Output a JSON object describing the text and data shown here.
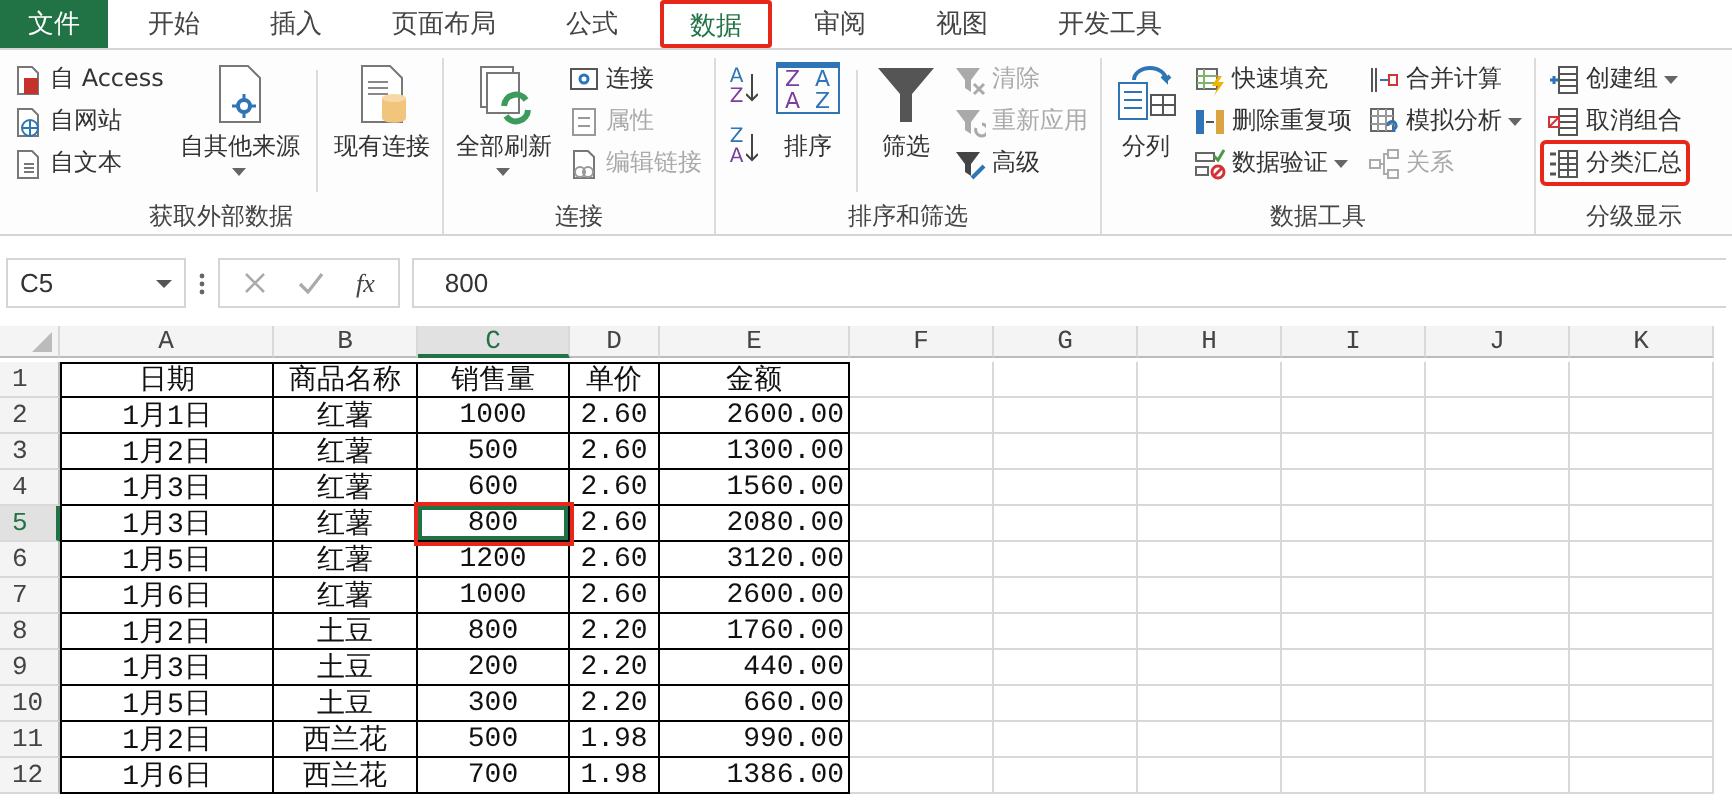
{
  "tabs": [
    {
      "label": "文件",
      "kind": "file",
      "selected": false,
      "highlighted": false
    },
    {
      "label": "开始",
      "kind": "tab",
      "selected": false,
      "highlighted": false
    },
    {
      "label": "插入",
      "kind": "tab",
      "selected": false,
      "highlighted": false
    },
    {
      "label": "页面布局",
      "kind": "tab",
      "selected": false,
      "highlighted": false
    },
    {
      "label": "公式",
      "kind": "tab",
      "selected": false,
      "highlighted": false
    },
    {
      "label": "数据",
      "kind": "tab",
      "selected": true,
      "highlighted": true
    },
    {
      "label": "审阅",
      "kind": "tab",
      "selected": false,
      "highlighted": false
    },
    {
      "label": "视图",
      "kind": "tab",
      "selected": false,
      "highlighted": false
    },
    {
      "label": "开发工具",
      "kind": "tab",
      "selected": false,
      "highlighted": false
    }
  ],
  "ribbon": {
    "groups": [
      {
        "label": "获取外部数据",
        "columns": [
          {
            "kind": "stack",
            "items": [
              {
                "label": "自 Access",
                "disabled": false,
                "caret": false,
                "highlighted": false
              },
              {
                "label": "自网站",
                "disabled": false,
                "caret": false,
                "highlighted": false
              },
              {
                "label": "自文本",
                "disabled": false,
                "caret": false,
                "highlighted": false
              }
            ]
          },
          {
            "kind": "large",
            "label": "自其他来源",
            "disabled": false,
            "caret": true
          },
          {
            "kind": "separator"
          },
          {
            "kind": "large",
            "label": "现有连接",
            "disabled": false,
            "caret": false
          }
        ]
      },
      {
        "label": "连接",
        "columns": [
          {
            "kind": "large",
            "label": "全部刷新",
            "disabled": false,
            "caret": true
          },
          {
            "kind": "stack",
            "items": [
              {
                "label": "连接",
                "disabled": false,
                "caret": false,
                "highlighted": false
              },
              {
                "label": "属性",
                "disabled": true,
                "caret": false,
                "highlighted": false
              },
              {
                "label": "编辑链接",
                "disabled": true,
                "caret": false,
                "highlighted": false
              }
            ]
          }
        ]
      },
      {
        "label": "排序和筛选",
        "columns": [
          {
            "kind": "sort_stack",
            "items": [
              {
                "top": "A",
                "bottom": "Z"
              },
              {
                "top": "Z",
                "bottom": "A"
              }
            ]
          },
          {
            "kind": "sort_large",
            "label": "排序",
            "letters": [
              "Z",
              "A",
              "A",
              "Z"
            ],
            "disabled": false,
            "caret": false
          },
          {
            "kind": "separator"
          },
          {
            "kind": "large",
            "label": "筛选",
            "disabled": false,
            "caret": false
          },
          {
            "kind": "stack",
            "items": [
              {
                "label": "清除",
                "disabled": true,
                "caret": false,
                "highlighted": false
              },
              {
                "label": "重新应用",
                "disabled": true,
                "caret": false,
                "highlighted": false
              },
              {
                "label": "高级",
                "disabled": false,
                "caret": false,
                "highlighted": false
              }
            ]
          }
        ]
      },
      {
        "label": "数据工具",
        "columns": [
          {
            "kind": "large",
            "label": "分列",
            "disabled": false,
            "caret": false
          },
          {
            "kind": "stack",
            "items": [
              {
                "label": "快速填充",
                "disabled": false,
                "caret": false,
                "highlighted": false
              },
              {
                "label": "删除重复项",
                "disabled": false,
                "caret": false,
                "highlighted": false
              },
              {
                "label": "数据验证",
                "disabled": false,
                "caret": true,
                "highlighted": false
              }
            ]
          },
          {
            "kind": "stack",
            "items": [
              {
                "label": "合并计算",
                "disabled": false,
                "caret": false,
                "highlighted": false
              },
              {
                "label": "模拟分析",
                "disabled": false,
                "caret": true,
                "highlighted": false
              },
              {
                "label": "关系",
                "disabled": true,
                "caret": false,
                "highlighted": false
              }
            ]
          }
        ]
      },
      {
        "label": "分级显示",
        "columns": [
          {
            "kind": "stack",
            "items": [
              {
                "label": "创建组",
                "disabled": false,
                "caret": true,
                "highlighted": false
              },
              {
                "label": "取消组合",
                "disabled": false,
                "caret": false,
                "highlighted": false
              },
              {
                "label": "分类汇总",
                "disabled": false,
                "caret": false,
                "highlighted": true
              }
            ]
          }
        ]
      }
    ]
  },
  "formula_bar": {
    "name_box": "C5",
    "function_label": "fx",
    "value": "800"
  },
  "sheet": {
    "columns": [
      "A",
      "B",
      "C",
      "D",
      "E",
      "F",
      "G",
      "H",
      "I",
      "J",
      "K"
    ],
    "rows": [
      {
        "header": "1",
        "cells": [
          {
            "text": "日期",
            "selected": false,
            "highlighted": false
          },
          {
            "text": "商品名称",
            "selected": false,
            "highlighted": false
          },
          {
            "text": "销售量",
            "selected": false,
            "highlighted": false
          },
          {
            "text": "单价",
            "selected": false,
            "highlighted": false
          },
          {
            "text": "金额",
            "selected": false,
            "highlighted": false
          }
        ]
      },
      {
        "header": "2",
        "cells": [
          {
            "text": "1月1日",
            "selected": false,
            "highlighted": false
          },
          {
            "text": "红薯",
            "selected": false,
            "highlighted": false
          },
          {
            "text": "1000",
            "selected": false,
            "highlighted": false
          },
          {
            "text": "2.60",
            "selected": false,
            "highlighted": false
          },
          {
            "text": "2600.00",
            "selected": false,
            "highlighted": false
          }
        ]
      },
      {
        "header": "3",
        "cells": [
          {
            "text": "1月2日",
            "selected": false,
            "highlighted": false
          },
          {
            "text": "红薯",
            "selected": false,
            "highlighted": false
          },
          {
            "text": "500",
            "selected": false,
            "highlighted": false
          },
          {
            "text": "2.60",
            "selected": false,
            "highlighted": false
          },
          {
            "text": "1300.00",
            "selected": false,
            "highlighted": false
          }
        ]
      },
      {
        "header": "4",
        "cells": [
          {
            "text": "1月3日",
            "selected": false,
            "highlighted": false
          },
          {
            "text": "红薯",
            "selected": false,
            "highlighted": false
          },
          {
            "text": "600",
            "selected": false,
            "highlighted": false
          },
          {
            "text": "2.60",
            "selected": false,
            "highlighted": false
          },
          {
            "text": "1560.00",
            "selected": false,
            "highlighted": false
          }
        ]
      },
      {
        "header": "5",
        "cells": [
          {
            "text": "1月3日",
            "selected": false,
            "highlighted": false
          },
          {
            "text": "红薯",
            "selected": false,
            "highlighted": false
          },
          {
            "text": "800",
            "selected": true,
            "highlighted": true
          },
          {
            "text": "2.60",
            "selected": false,
            "highlighted": false
          },
          {
            "text": "2080.00",
            "selected": false,
            "highlighted": false
          }
        ]
      },
      {
        "header": "6",
        "cells": [
          {
            "text": "1月5日",
            "selected": false,
            "highlighted": false
          },
          {
            "text": "红薯",
            "selected": false,
            "highlighted": false
          },
          {
            "text": "1200",
            "selected": false,
            "highlighted": false
          },
          {
            "text": "2.60",
            "selected": false,
            "highlighted": false
          },
          {
            "text": "3120.00",
            "selected": false,
            "highlighted": false
          }
        ]
      },
      {
        "header": "7",
        "cells": [
          {
            "text": "1月6日",
            "selected": false,
            "highlighted": false
          },
          {
            "text": "红薯",
            "selected": false,
            "highlighted": false
          },
          {
            "text": "1000",
            "selected": false,
            "highlighted": false
          },
          {
            "text": "2.60",
            "selected": false,
            "highlighted": false
          },
          {
            "text": "2600.00",
            "selected": false,
            "highlighted": false
          }
        ]
      },
      {
        "header": "8",
        "cells": [
          {
            "text": "1月2日",
            "selected": false,
            "highlighted": false
          },
          {
            "text": "土豆",
            "selected": false,
            "highlighted": false
          },
          {
            "text": "800",
            "selected": false,
            "highlighted": false
          },
          {
            "text": "2.20",
            "selected": false,
            "highlighted": false
          },
          {
            "text": "1760.00",
            "selected": false,
            "highlighted": false
          }
        ]
      },
      {
        "header": "9",
        "cells": [
          {
            "text": "1月3日",
            "selected": false,
            "highlighted": false
          },
          {
            "text": "土豆",
            "selected": false,
            "highlighted": false
          },
          {
            "text": "200",
            "selected": false,
            "highlighted": false
          },
          {
            "text": "2.20",
            "selected": false,
            "highlighted": false
          },
          {
            "text": "440.00",
            "selected": false,
            "highlighted": false
          }
        ]
      },
      {
        "header": "10",
        "cells": [
          {
            "text": "1月5日",
            "selected": false,
            "highlighted": false
          },
          {
            "text": "土豆",
            "selected": false,
            "highlighted": false
          },
          {
            "text": "300",
            "selected": false,
            "highlighted": false
          },
          {
            "text": "2.20",
            "selected": false,
            "highlighted": false
          },
          {
            "text": "660.00",
            "selected": false,
            "highlighted": false
          }
        ]
      },
      {
        "header": "11",
        "cells": [
          {
            "text": "1月2日",
            "selected": false,
            "highlighted": false
          },
          {
            "text": "西兰花",
            "selected": false,
            "highlighted": false
          },
          {
            "text": "500",
            "selected": false,
            "highlighted": false
          },
          {
            "text": "1.98",
            "selected": false,
            "highlighted": false
          },
          {
            "text": "990.00",
            "selected": false,
            "highlighted": false
          }
        ]
      },
      {
        "header": "12",
        "cells": [
          {
            "text": "1月6日",
            "selected": false,
            "highlighted": false
          },
          {
            "text": "西兰花",
            "selected": false,
            "highlighted": false
          },
          {
            "text": "700",
            "selected": false,
            "highlighted": false
          },
          {
            "text": "1.98",
            "selected": false,
            "highlighted": false
          },
          {
            "text": "1386.00",
            "selected": false,
            "highlighted": false
          }
        ]
      }
    ]
  }
}
